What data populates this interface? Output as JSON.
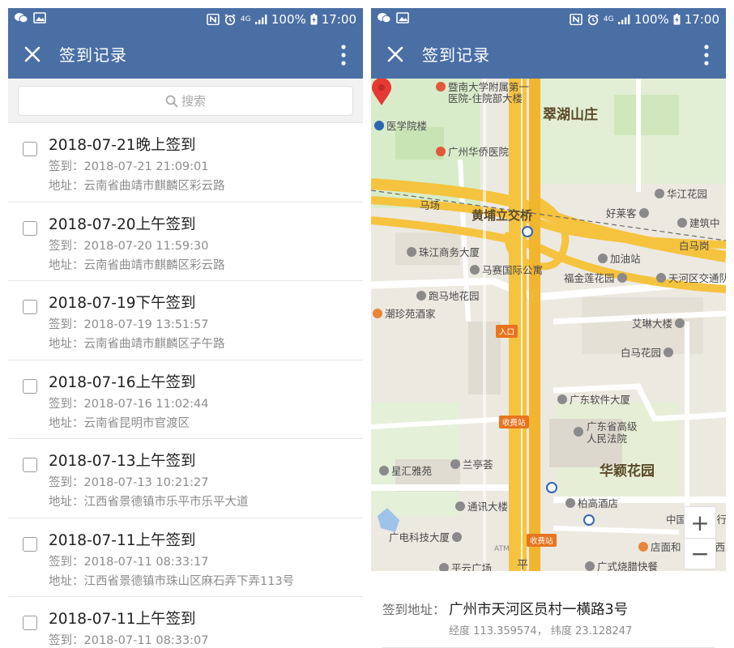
{
  "status_bar": {
    "network": "4G",
    "battery": "100%",
    "time": "17:00"
  },
  "left_screen": {
    "title": "签到记录",
    "search_placeholder": "搜索",
    "records": [
      {
        "title": "2018-07-21晚上签到",
        "time_line": "签到：2018-07-21 21:09:01",
        "address_line": "地址：云南省曲靖市麒麟区彩云路"
      },
      {
        "title": "2018-07-20上午签到",
        "time_line": "签到：2018-07-20 11:59:30",
        "address_line": "地址：云南省曲靖市麒麟区彩云路"
      },
      {
        "title": "2018-07-19下午签到",
        "time_line": "签到：2018-07-19 13:51:57",
        "address_line": "地址：云南省曲靖市麒麟区子午路"
      },
      {
        "title": "2018-07-16上午签到",
        "time_line": "签到：2018-07-16 11:02:44",
        "address_line": "地址：云南省昆明市官渡区"
      },
      {
        "title": "2018-07-13上午签到",
        "time_line": "签到：2018-07-13 10:21:27",
        "address_line": "地址：江西省景德镇市乐平市乐平大道"
      },
      {
        "title": "2018-07-11上午签到",
        "time_line": "签到：2018-07-11 08:33:17",
        "address_line": "地址：江西省景德镇市珠山区麻石弄下弄113号"
      },
      {
        "title": "2018-07-11上午签到",
        "time_line": "签到：2018-07-11 08:33:07",
        "address_line": ""
      }
    ]
  },
  "right_screen": {
    "title": "签到记录",
    "map": {
      "labels": {
        "hospital_1": "暨南大学附属第一医院-住院部大楼",
        "hospital_1_line1": "暨南大学附属第一",
        "hospital_1_line2": "医院-住院部大楼",
        "cuihu": "翠湖山庄",
        "medical_bldg": "医学院楼",
        "huaqiao_hospital": "广州华侨医院",
        "huajiang": "华江花园",
        "machang": "马场",
        "huangpu_bridge": "黄埔立交桥",
        "haolaike": "好莱客",
        "jianyin": "建筑中",
        "baimagang": "白马岗",
        "zhujiang": "珠江商务大厦",
        "jiayouzhan": "加油站",
        "masai": "马赛国际公寓",
        "fujin": "福金莲花园",
        "tianhe_police": "天河区交通队",
        "paoma": "跑马地花园",
        "chaozhen": "潮珍苑酒家",
        "entrance": "入口",
        "ailin": "艾琳大楼",
        "baima_garden": "白马花园",
        "software": "广东软件大厦",
        "toll_1": "收费站",
        "court_line1": "广东省高级",
        "court_line2": "人民法院",
        "huaying": "华颖花园",
        "xinghui": "星汇雅苑",
        "lantingqi": "兰亭荟",
        "tongxun": "通讯大楼",
        "baigao": "柏高酒店",
        "zhongguo": "中国建设银行",
        "guangdian": "广电科技大厦",
        "toll_2": "收费站",
        "dianmian": "店面和",
        "jiangxi": "江西",
        "pingyun": "平云广场",
        "ping": "平",
        "guangshi": "广式烧腊快餐",
        "atm": "ATM"
      }
    },
    "address_label": "签到地址：",
    "address_value": "广州市天河区员村一横路3号",
    "coordinates": "经度 113.359574， 纬度 23.128247"
  }
}
